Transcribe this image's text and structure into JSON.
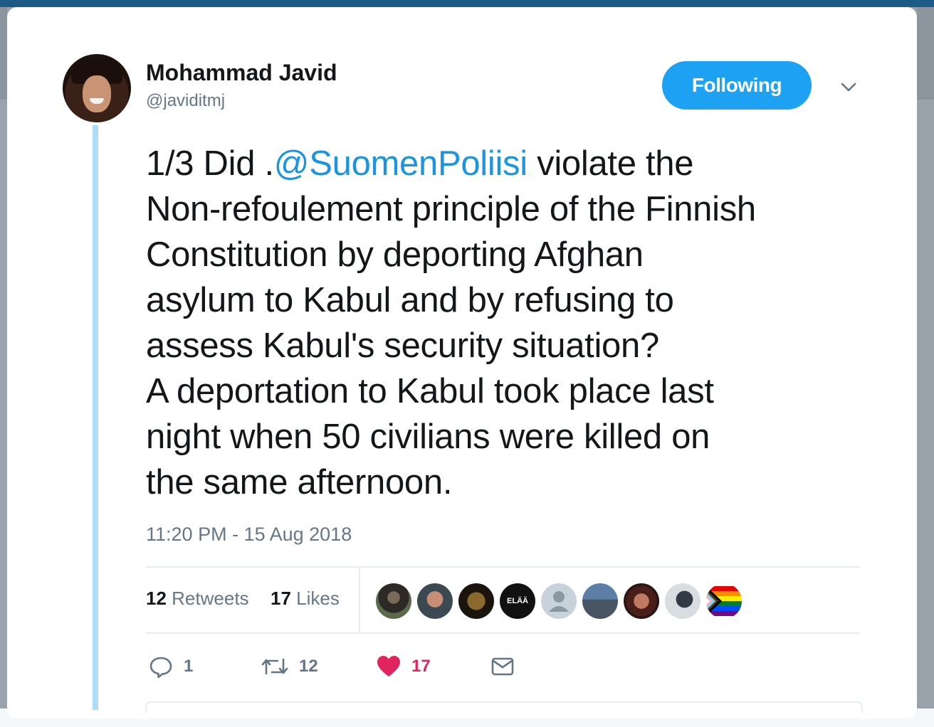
{
  "author": {
    "name": "Mohammad Javid",
    "handle": "@javiditmj"
  },
  "follow_button": {
    "label": "Following"
  },
  "tweet": {
    "lines": [
      {
        "pre": "1/3  Did .",
        "mention": "@SuomenPoliisi",
        "post": " violate the"
      },
      "Non-refoulement principle of the Finnish",
      "Constitution by deporting Afghan",
      "asylum to Kabul and by refusing to",
      "assess Kabul's security situation?",
      "A deportation to Kabul took place last",
      "night when 50 civilians were killed on",
      "the same afternoon."
    ],
    "timestamp": "11:20 PM - 15 Aug 2018"
  },
  "stats": {
    "retweets_count": "12",
    "retweets_label": "Retweets",
    "likes_count": "17",
    "likes_label": "Likes"
  },
  "liker_avatars": [
    "liker-avatar-1",
    "liker-avatar-2",
    "liker-avatar-3",
    "liker-avatar-4",
    "liker-avatar-5",
    "liker-avatar-6",
    "liker-avatar-7",
    "liker-avatar-8",
    "liker-avatar-9"
  ],
  "liker_badge_text": "ELÄÄ",
  "actions": {
    "reply_count": "1",
    "retweet_count": "12",
    "like_count": "17"
  },
  "colors": {
    "accent": "#1da1f2",
    "link": "#1b95e0",
    "like": "#e0245e",
    "muted": "#657786",
    "thread_line": "#aedcf6"
  },
  "icons": {
    "caret": "chevron-down-icon",
    "reply": "reply-icon",
    "retweet": "retweet-icon",
    "like": "heart-icon",
    "dm": "envelope-icon"
  }
}
